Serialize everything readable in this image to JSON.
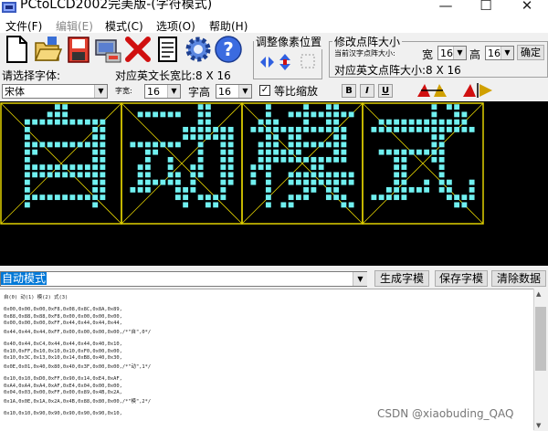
{
  "window": {
    "title": "PCtoLCD2002完美版-(字符模式)",
    "minimize": "—",
    "maximize": "☐",
    "close": "✕"
  },
  "menu": [
    {
      "label": "文件(F)",
      "enabled": true
    },
    {
      "label": "编辑(E)",
      "enabled": false
    },
    {
      "label": "模式(C)",
      "enabled": true
    },
    {
      "label": "选项(O)",
      "enabled": true
    },
    {
      "label": "帮助(H)",
      "enabled": true
    }
  ],
  "toolbar_icons": [
    "new-file-icon",
    "open-folder-icon",
    "save-disk-icon",
    "settings-icon",
    "delete-icon",
    "document-icon",
    "gear-icon",
    "help-icon"
  ],
  "font": {
    "select_label": "请选择字体:",
    "font_value": "宋体",
    "width_small_label": "字宽:",
    "width_value": "16",
    "height_label": "字高",
    "height_value": "16",
    "english_size_label": "对应英文长宽比:8 X 16",
    "proportional_label": "等比缩放",
    "proportional_checked": true,
    "bold": "B",
    "italic": "I",
    "underline": "U"
  },
  "adjust": {
    "title": "调整像素位置"
  },
  "dot_size": {
    "title": "修改点阵大小",
    "current_label": "当前汉字点阵大小:",
    "width_label": "宽",
    "width_value": "16",
    "height_label": "高",
    "height_value": "16",
    "confirm": "确定",
    "english_label": "对应英文点阵大小:8 X 16"
  },
  "canvas_chars": [
    "自",
    "动",
    "模",
    "式"
  ],
  "input": {
    "value": "自动模式"
  },
  "buttons": {
    "generate": "生成字模",
    "save": "保存字模",
    "clear": "清除数据"
  },
  "output_lines": [
    "自(0) 动(1) 模(2) 式(3)",
    "",
    "0x00,0x00,0x00,0xF8,0x08,0x8C,0x8A,0x89,",
    "0x88,0x88,0x88,0xF8,0x00,0x00,0x00,0x00,",
    "0x00,0x00,0x00,0xFF,0x44,0x44,0x44,0x44,",
    "0x44,0x44,0x44,0xFF,0x00,0x00,0x00,0x00,/*\"自\",0*/",
    "",
    "0x40,0x44,0xC4,0x44,0x44,0x44,0x40,0x10,",
    "0x10,0xFF,0x10,0x10,0x10,0xF0,0x00,0x00,",
    "0x10,0x3C,0x13,0x10,0x14,0xB8,0x40,0x30,",
    "0x0E,0x01,0x40,0x80,0x40,0x3F,0x00,0x00,/*\"动\",1*/",
    "",
    "0x10,0x10,0xD0,0xFF,0x90,0x14,0xE4,0xAF,",
    "0xA4,0xA4,0xA4,0xAF,0xE4,0x04,0x00,0x00,",
    "0x04,0x03,0x00,0xFF,0x00,0x89,0x4B,0x2A,",
    "0x1A,0x0E,0x1A,0x2A,0x4B,0x88,0x80,0x00,/*\"模\",2*/",
    "",
    "0x10,0x10,0x90,0x90,0x90,0x90,0x90,0x10,"
  ],
  "watermark": "CSDN @xiaobuding_QAQ",
  "colors": {
    "pixel": "#70f0f0",
    "grid": "#e0d000",
    "canvas_bg": "#000000",
    "selection": "#0078d7"
  }
}
